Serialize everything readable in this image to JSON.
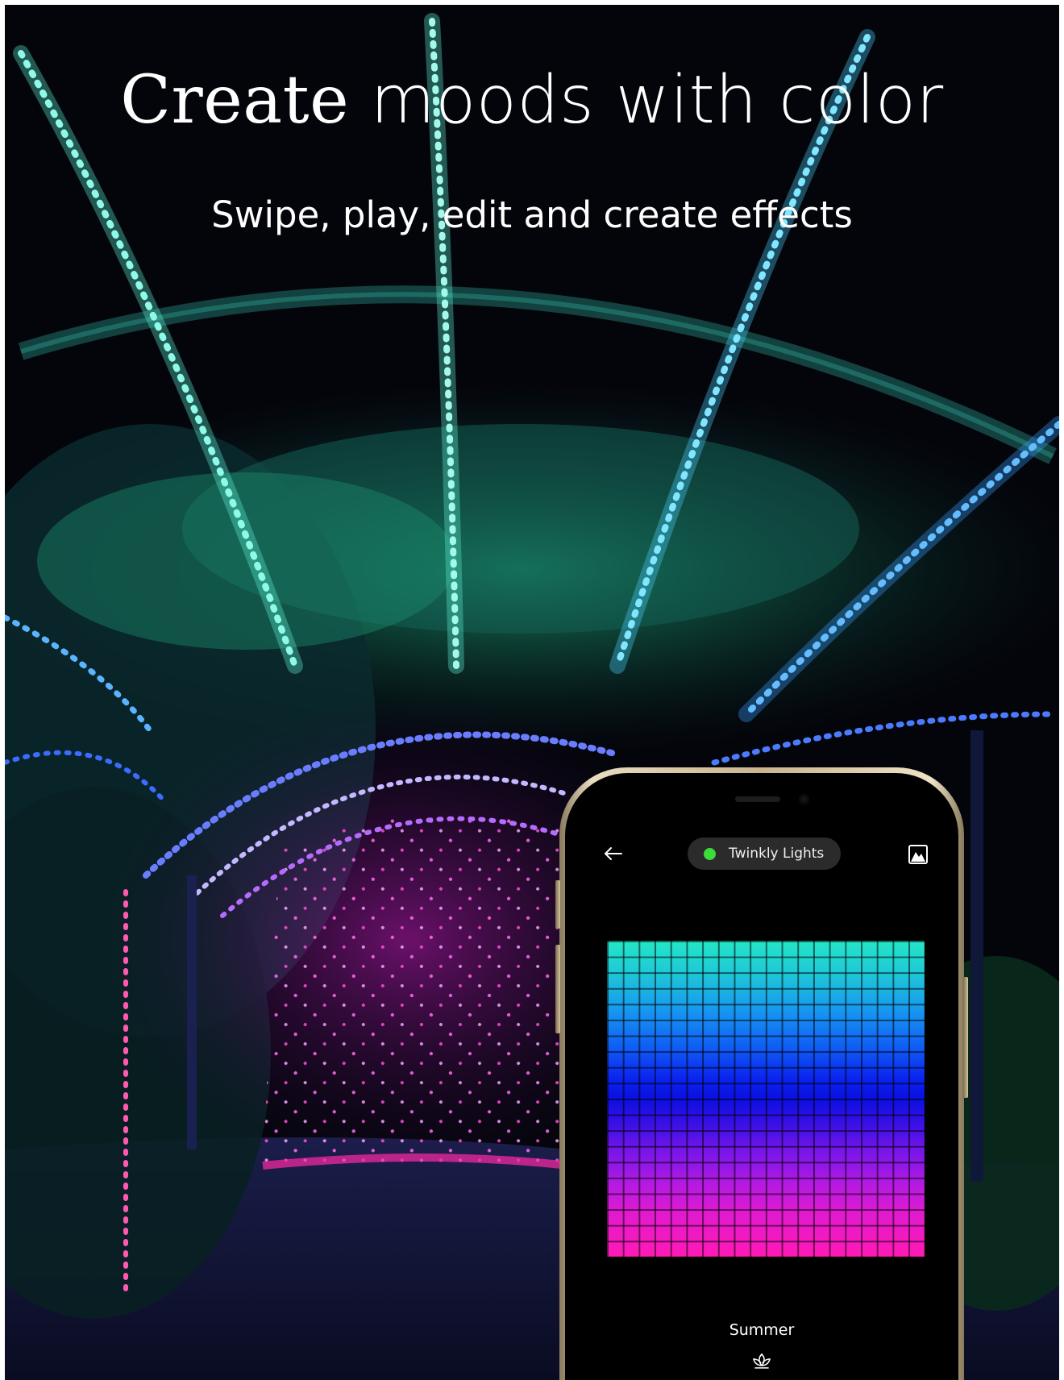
{
  "banner": {
    "title_part1": "Create",
    "title_part2": "moods with color",
    "subtitle": "Swipe, play, edit and create effects"
  },
  "phone": {
    "device_name": "Twinkly Lights",
    "device_status_color": "#3ddc3a",
    "back_icon": "arrow-left-icon",
    "mapping_icon": "image-mountain-icon",
    "effect_name": "Summer",
    "effect_icon": "lotus-icon"
  },
  "colors": {
    "grid_top": "#23e6c6",
    "grid_middle": "#0a10e0",
    "grid_bottom": "#ff1ab4"
  }
}
